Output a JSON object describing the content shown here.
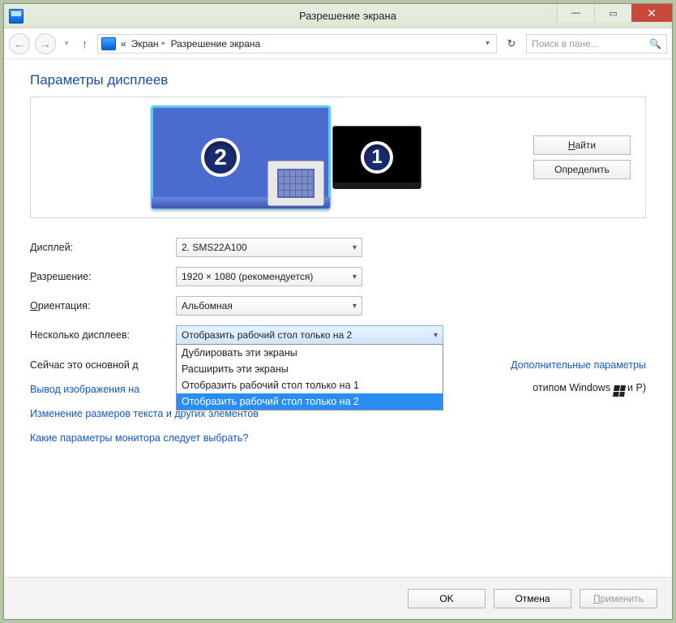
{
  "window": {
    "title": "Разрешение экрана"
  },
  "nav": {
    "back_icon": "←",
    "fwd_icon": "→",
    "up_icon": "↑",
    "history_icon": "▾",
    "prefix": "«",
    "seg1": "Экран",
    "seg2": "Разрешение экрана",
    "refresh_icon": "↻",
    "search_placeholder": "Поиск в пане...",
    "search_icon": "🔍"
  },
  "main": {
    "heading": "Параметры дисплеев",
    "monitor1_num": "1",
    "monitor2_num": "2",
    "find_btn": "Найти",
    "find_u": "Н",
    "identify_btn": "Определить",
    "form": {
      "display_label": "Дисплей:",
      "display_u": "Д",
      "display_value": "2. SMS22A100",
      "resolution_label": "Разрешение:",
      "resolution_u": "Р",
      "resolution_value": "1920 × 1080 (рекомендуется)",
      "orientation_label": "Ориентация:",
      "orientation_u": "О",
      "orientation_value": "Альбомная",
      "multi_label": "Несколько дисплеев:",
      "multi_value": "Отобразить рабочий стол только на 2",
      "multi_options": [
        "Дублировать эти экраны",
        "Расширить эти экраны",
        "Отобразить рабочий стол только на 1",
        "Отобразить рабочий стол только на 2"
      ],
      "multi_selected_index": 3
    },
    "primary_text_before": "Сейчас это основной д",
    "advanced_link": "Дополнительные параметры",
    "projector_before": "Вывод изображения на",
    "projector_after": "отипом Windows",
    "projector_key": " и P)",
    "text_size_link": "Изменение размеров текста и других элементов",
    "which_link": "Какие параметры монитора следует выбрать?"
  },
  "footer": {
    "ok": "OK",
    "cancel": "Отмена",
    "apply": "Применить",
    "apply_u": "П"
  }
}
